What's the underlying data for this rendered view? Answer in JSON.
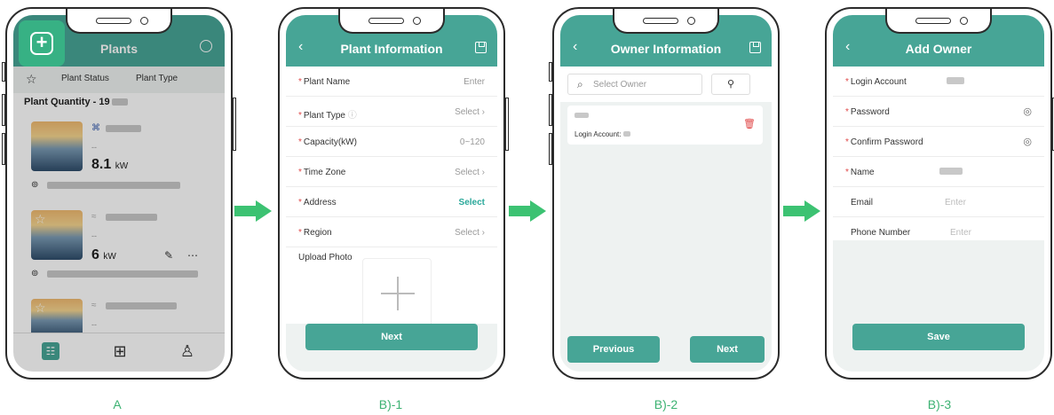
{
  "captions": [
    "A",
    "B)-1",
    "B)-2",
    "B)-3"
  ],
  "colors": {
    "teal": "#47a596",
    "green_arrow": "#3cc272",
    "required": "#e04848"
  },
  "phoneA": {
    "title": "Plants",
    "filter_plant_status": "Plant Status",
    "filter_plant_type": "Plant Type",
    "quantity": "Plant Quantity - 19",
    "cards": [
      {
        "power": "8.1",
        "unit": "kW",
        "dash": "--"
      },
      {
        "power": "6",
        "unit": "kW",
        "dash": "--"
      },
      {
        "power": "",
        "unit": "",
        "dash": "--"
      }
    ]
  },
  "phoneB1": {
    "title": "Plant Information",
    "rows": [
      {
        "label": "Plant Name",
        "value": "Enter"
      },
      {
        "label": "Plant Type",
        "value": "Select"
      },
      {
        "label": "Capacity(kW)",
        "value": "0~120"
      },
      {
        "label": "Time Zone",
        "value": "Select"
      },
      {
        "label": "Address",
        "value": "Select"
      },
      {
        "label": "Region",
        "value": "Select"
      }
    ],
    "upload_label": "Upload Photo",
    "next": "Next"
  },
  "phoneB2": {
    "title": "Owner Information",
    "search_placeholder": "Select Owner",
    "owner_login": "Login Account:",
    "previous": "Previous",
    "next": "Next"
  },
  "phoneB3": {
    "title": "Add Owner",
    "rows": [
      {
        "label": "Login Account",
        "value": ""
      },
      {
        "label": "Password",
        "value": ""
      },
      {
        "label": "Confirm Password",
        "value": ""
      },
      {
        "label": "Name",
        "value": ""
      },
      {
        "label": "Email",
        "value": "Enter"
      },
      {
        "label": "Phone Number",
        "value": "Enter"
      }
    ],
    "save": "Save"
  }
}
